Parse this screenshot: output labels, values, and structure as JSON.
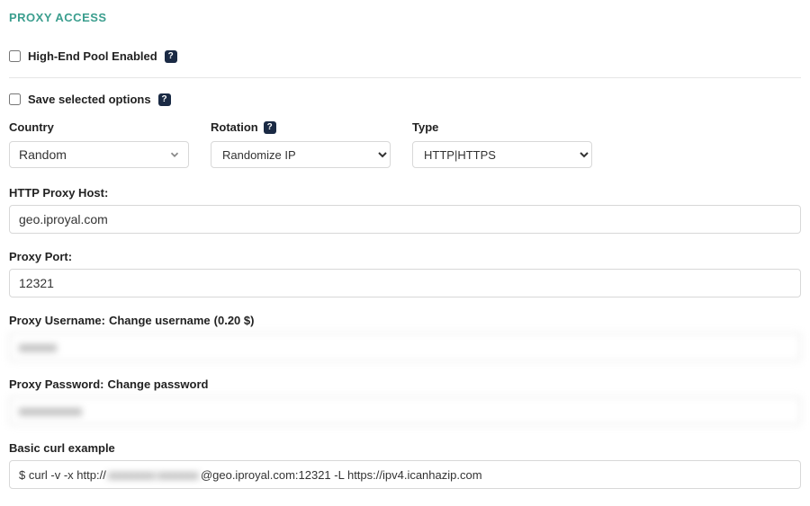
{
  "section_title": "PROXY ACCESS",
  "highend": {
    "label": "High-End Pool Enabled",
    "checked": false
  },
  "save_options": {
    "label": "Save selected options",
    "checked": false
  },
  "country": {
    "label": "Country",
    "selected": "Random"
  },
  "rotation": {
    "label": "Rotation",
    "selected": "Randomize IP"
  },
  "type": {
    "label": "Type",
    "selected": "HTTP|HTTPS"
  },
  "proxy_host": {
    "label": "HTTP Proxy Host:",
    "value": "geo.iproyal.com"
  },
  "proxy_port": {
    "label": "Proxy Port:",
    "value": "12321"
  },
  "proxy_username": {
    "label_prefix": "Proxy Username: ",
    "action": "Change username",
    "price": " (0.20 $)",
    "value": "xxxxxx"
  },
  "proxy_password": {
    "label_prefix": "Proxy Password: ",
    "action": "Change password",
    "value": "xxxxxxxxxx"
  },
  "curl": {
    "label": "Basic curl example",
    "prefix": "$ curl -v -x http://",
    "cred": "xxxxxxxx:xxxxxxx",
    "suffix": "@geo.iproyal.com:12321 -L https://ipv4.icanhazip.com"
  },
  "icons": {
    "help": "?"
  }
}
